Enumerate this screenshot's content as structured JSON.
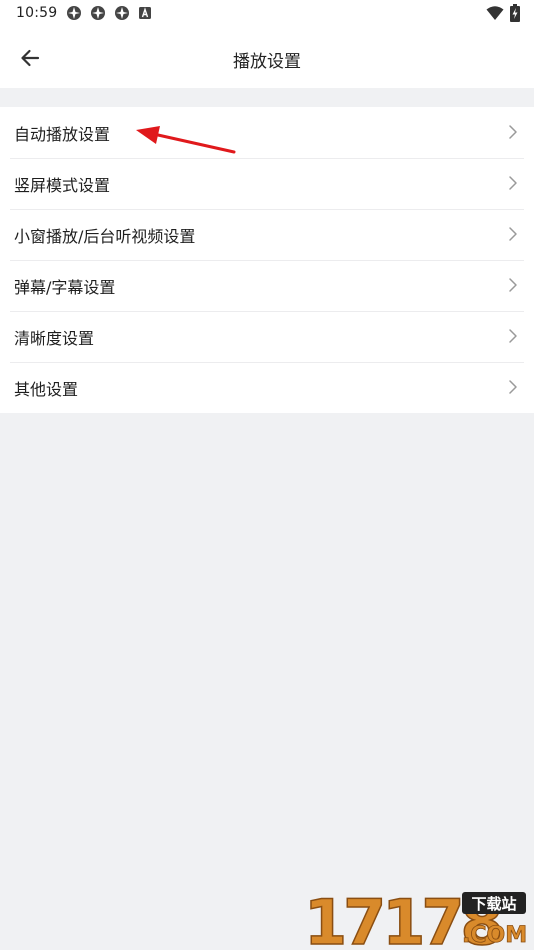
{
  "status_bar": {
    "time": "10:59",
    "left_icons": [
      "notification-icon",
      "notification-icon",
      "notification-icon",
      "keyboard-a-icon"
    ],
    "right_icons": [
      "wifi-icon",
      "battery-icon"
    ]
  },
  "header": {
    "title": "播放设置",
    "back_icon": "arrow-left-icon"
  },
  "settings": {
    "items": [
      {
        "label": "自动播放设置",
        "icon": "chevron-right-icon"
      },
      {
        "label": "竖屏模式设置",
        "icon": "chevron-right-icon"
      },
      {
        "label": "小窗播放/后台听视频设置",
        "icon": "chevron-right-icon"
      },
      {
        "label": "弹幕/字幕设置",
        "icon": "chevron-right-icon"
      },
      {
        "label": "清晰度设置",
        "icon": "chevron-right-icon"
      },
      {
        "label": "其他设置",
        "icon": "chevron-right-icon"
      }
    ]
  },
  "annotation": {
    "icon": "red-arrow-annotation",
    "color": "#e0191c"
  },
  "watermark": {
    "number": "17178",
    "badge": "下载站",
    "suffix": ".COM",
    "colors": {
      "digits": "#d98a2b",
      "badge_bg": "#222222",
      "badge_text": "#ffffff"
    }
  },
  "colors": {
    "page_background": "#f0f1f3",
    "surface": "#ffffff",
    "text": "#1f1f1f",
    "divider": "#ececee",
    "chevron": "#9a9a9a"
  }
}
